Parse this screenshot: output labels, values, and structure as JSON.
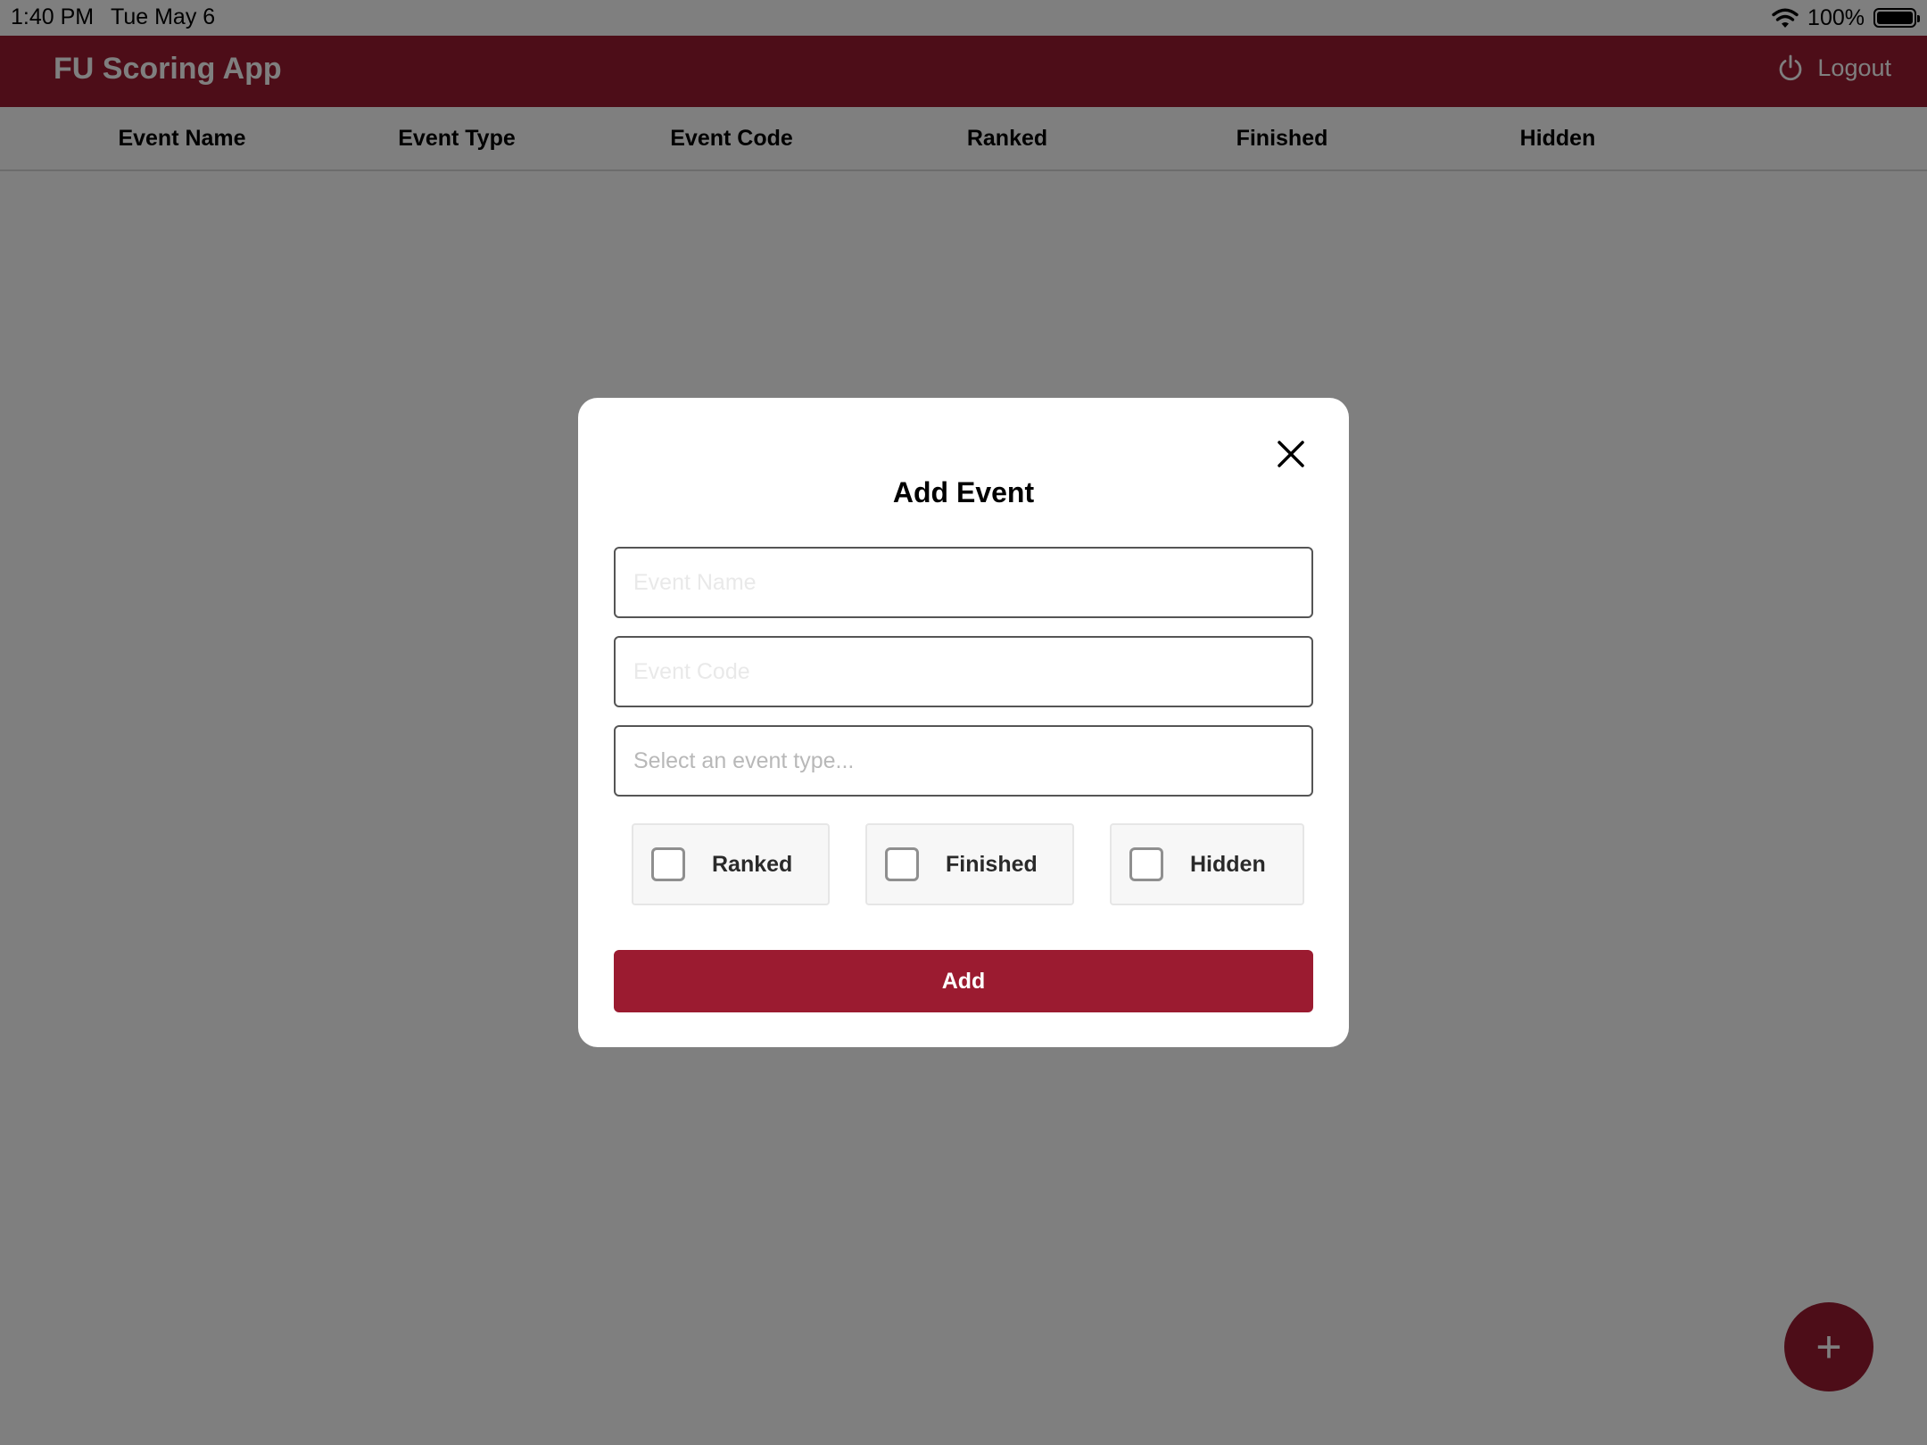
{
  "status_bar": {
    "time": "1:40 PM",
    "date": "Tue May 6",
    "battery": "100%"
  },
  "app": {
    "title": "FU Scoring App",
    "logout_label": "Logout",
    "brand_color": "#9b1b30"
  },
  "table": {
    "columns": [
      "Event Name",
      "Event Type",
      "Event Code",
      "Ranked",
      "Finished",
      "Hidden"
    ],
    "rows": []
  },
  "fab": {
    "label": "+"
  },
  "modal": {
    "title": "Add Event",
    "event_name": {
      "value": "",
      "placeholder": "Event Name"
    },
    "event_code": {
      "value": "",
      "placeholder": "Event Code"
    },
    "event_type": {
      "value": "",
      "placeholder": "Select an event type..."
    },
    "checkboxes": [
      {
        "label": "Ranked",
        "checked": false
      },
      {
        "label": "Finished",
        "checked": false
      },
      {
        "label": "Hidden",
        "checked": false
      }
    ],
    "submit_label": "Add"
  },
  "icons": {
    "close": "close-icon",
    "logout": "power-icon",
    "wifi": "wifi-icon",
    "battery": "battery-icon",
    "fab": "plus-icon"
  }
}
